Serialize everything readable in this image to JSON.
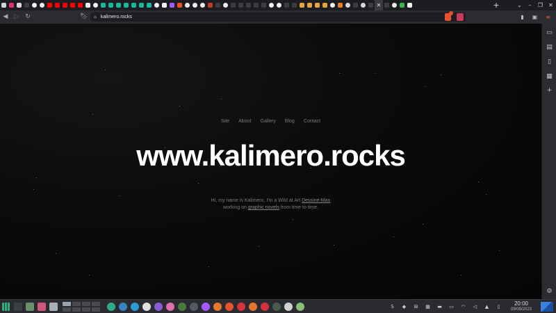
{
  "browser": {
    "url": "kalimero.rocks",
    "new_tab_label": "+",
    "window_controls": [
      "⌄",
      "–",
      "❐",
      "✕"
    ]
  },
  "tabs": [
    {
      "icon": "app-menu-icon",
      "color": "#cfd3da"
    },
    {
      "icon": "instagram-icon",
      "color": "#e1306c"
    },
    {
      "icon": "brave-lion-icon",
      "color": "#d9d9d9"
    },
    {
      "icon": "tab-icon",
      "color": "#3b3d42"
    },
    {
      "icon": "github-icon",
      "color": "#f0f0f0"
    },
    {
      "icon": "github-icon",
      "color": "#f0f0f0"
    },
    {
      "icon": "youtube-icon",
      "color": "#ff0000"
    },
    {
      "icon": "youtube-icon",
      "color": "#ff0000"
    },
    {
      "icon": "youtube-icon",
      "color": "#ff0000"
    },
    {
      "icon": "youtube-icon",
      "color": "#ff0000"
    },
    {
      "icon": "youtube-icon",
      "color": "#ff0000"
    },
    {
      "icon": "triangle-icon",
      "color": "#f0f0f0"
    },
    {
      "icon": "github-icon",
      "color": "#f0f0f0"
    },
    {
      "icon": "teal-app-icon",
      "color": "#18b8a0"
    },
    {
      "icon": "teal-app-icon",
      "color": "#18b8a0"
    },
    {
      "icon": "teal-app-icon",
      "color": "#18b8a0"
    },
    {
      "icon": "teal-app-icon",
      "color": "#18b8a0"
    },
    {
      "icon": "teal-app-icon",
      "color": "#18b8a0"
    },
    {
      "icon": "teal-app-icon",
      "color": "#18b8a0"
    },
    {
      "icon": "teal-app-icon",
      "color": "#18b8a0"
    },
    {
      "icon": "github-icon",
      "color": "#f0f0f0"
    },
    {
      "icon": "hexagon-icon",
      "color": "#f0f0f0"
    },
    {
      "icon": "figma-icon",
      "color": "#a259ff"
    },
    {
      "icon": "figma-icon",
      "color": "#f24e1e"
    },
    {
      "icon": "github-icon",
      "color": "#f0f0f0"
    },
    {
      "icon": "github-icon",
      "color": "#f0f0f0"
    },
    {
      "icon": "github-icon",
      "color": "#f0f0f0"
    },
    {
      "icon": "red-app-icon",
      "color": "#c0392b"
    },
    {
      "icon": "tab-icon",
      "color": "#3b3d42"
    },
    {
      "icon": "github-icon",
      "color": "#f0f0f0"
    },
    {
      "icon": "tab-icon",
      "color": "#3b3d42"
    },
    {
      "icon": "tab-icon",
      "color": "#3b3d42"
    },
    {
      "icon": "tab-icon",
      "color": "#3b3d42"
    },
    {
      "icon": "tab-icon",
      "color": "#3b3d42"
    },
    {
      "icon": "tab-icon",
      "color": "#3b3d42"
    },
    {
      "icon": "github-icon",
      "color": "#f0f0f0"
    },
    {
      "icon": "github-icon",
      "color": "#f0f0f0"
    },
    {
      "icon": "tab-icon",
      "color": "#3b3d42"
    },
    {
      "icon": "tab-icon",
      "color": "#3b3d42"
    },
    {
      "icon": "orange-app-icon",
      "color": "#e8a33a"
    },
    {
      "icon": "orange-app-icon",
      "color": "#e8a33a"
    },
    {
      "icon": "orange-app-icon",
      "color": "#e8a33a"
    },
    {
      "icon": "orange-app-icon",
      "color": "#e8a33a"
    },
    {
      "icon": "github-icon",
      "color": "#f0f0f0"
    },
    {
      "icon": "orange-app-icon",
      "color": "#e87d2a"
    },
    {
      "icon": "chrome-icon",
      "color": "#d9d9d9"
    },
    {
      "icon": "tab-icon",
      "color": "#3b3d42"
    },
    {
      "icon": "globe-icon",
      "color": "#d9d9d9"
    },
    {
      "icon": "tab-icon",
      "color": "#3b3d42"
    },
    {
      "icon": "close-icon",
      "color": "#3a3b40",
      "active": true
    },
    {
      "icon": "tab-icon",
      "color": "#3b3d42"
    },
    {
      "icon": "github-icon",
      "color": "#f0f0f0"
    },
    {
      "icon": "green-app-icon",
      "color": "#3cb44b"
    },
    {
      "icon": "triangle-icon",
      "color": "#f0f0f0"
    }
  ],
  "sidebar_icons": [
    "tv-icon",
    "wallet-icon",
    "bookmark-icon",
    "reading-list-icon",
    "add-icon",
    "settings-icon"
  ],
  "site": {
    "nav": [
      "Site",
      "About",
      "Gallery",
      "Blog",
      "Contact"
    ],
    "title": "www.kalimero.rocks",
    "intro_line1_before": "Hi, my name is Kalimero, I'm a Wild at Art ",
    "intro_link1": "Dessine-Man",
    "intro_line2_before": "working on ",
    "intro_link2": "graphic novels",
    "intro_line2_after": " from time to time."
  },
  "taskbar": {
    "apps": [
      {
        "icon": "terminal-icon",
        "color": "#3c3f46"
      },
      {
        "icon": "file-manager-icon",
        "color": "#6b8e6b"
      },
      {
        "icon": "download-icon",
        "color": "#d0577a"
      },
      {
        "icon": "stack-icon",
        "color": "#aab0b8"
      }
    ],
    "launchers": [
      {
        "icon": "refresh-icon",
        "color": "#2fa98c"
      },
      {
        "icon": "circle-app-icon",
        "color": "#3b82c4"
      },
      {
        "icon": "bird-icon",
        "color": "#2d9bd8"
      },
      {
        "icon": "inkscape-icon",
        "color": "#e0e0e0"
      },
      {
        "icon": "purple-app-icon",
        "color": "#8a5cd0"
      },
      {
        "icon": "color-wheel-icon",
        "color": "#e06fb0"
      },
      {
        "icon": "editor-icon",
        "color": "#4a7b3a"
      },
      {
        "icon": "dot-app-icon",
        "color": "#555a62"
      },
      {
        "icon": "figma-icon",
        "color": "#a259ff"
      },
      {
        "icon": "orange-circle-icon",
        "color": "#e8782f"
      },
      {
        "icon": "brave-icon",
        "color": "#e5542c"
      },
      {
        "icon": "opera-icon",
        "color": "#d8323c"
      },
      {
        "icon": "firefox-icon",
        "color": "#e8742f"
      },
      {
        "icon": "vivaldi-icon",
        "color": "#d0343a"
      },
      {
        "icon": "terminal-check-icon",
        "color": "#4a5a4a"
      },
      {
        "icon": "clipboard-icon",
        "color": "#d0d0d0"
      },
      {
        "icon": "bus-icon",
        "color": "#8abf7a"
      }
    ],
    "tray": [
      "skype-icon",
      "dropbox-icon",
      "network-icon",
      "calendar-icon",
      "folder-icon",
      "display-icon",
      "wifi-icon",
      "volume-icon",
      "expand-icon",
      "battery-icon"
    ],
    "time": "20:00",
    "date": "09/09/2023"
  }
}
